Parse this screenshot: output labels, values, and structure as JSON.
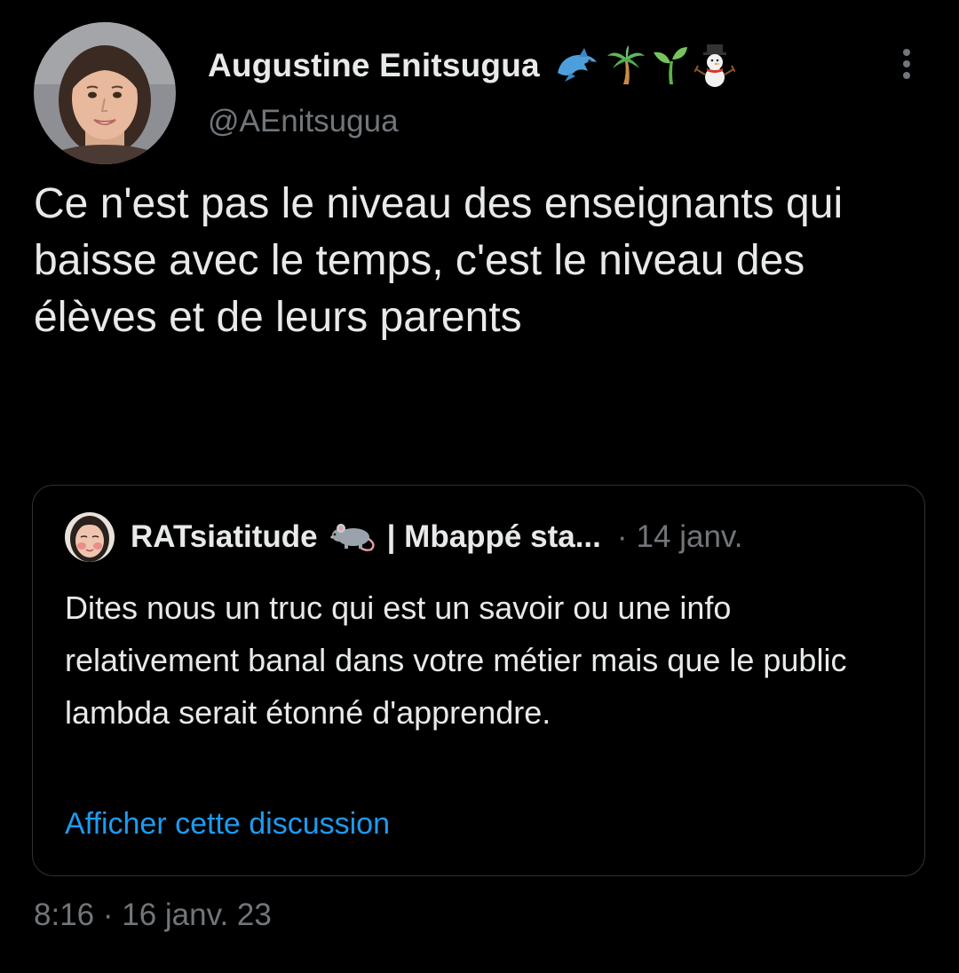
{
  "author": {
    "display_name": "Augustine Enitsugua",
    "name_emojis": [
      "dolphin-emoji",
      "palm-tree-emoji",
      "seedling-emoji",
      "snowman-emoji"
    ],
    "handle": "@AEnitsugua"
  },
  "tweet": {
    "text": "Ce n'est pas le niveau des enseignants qui baisse avec le temps, c'est le niveau des élèves et de leurs parents",
    "timestamp": "8:16 · 16 janv. 23"
  },
  "quoted_tweet": {
    "author_name": "RATsiatitude",
    "author_name_suffix": "| Mbappé sta...",
    "separator": "·",
    "date": "14 janv.",
    "text": "Dites nous un truc qui est un savoir ou une info relativement banal dans votre métier mais que le public lambda serait étonné d'apprendre.",
    "show_thread_label": "Afficher cette discussion"
  },
  "colors": {
    "background": "#000000",
    "primary_text": "#e7e9ea",
    "secondary_text": "#71767b",
    "link": "#1d9bf0",
    "border": "#2f3336"
  }
}
